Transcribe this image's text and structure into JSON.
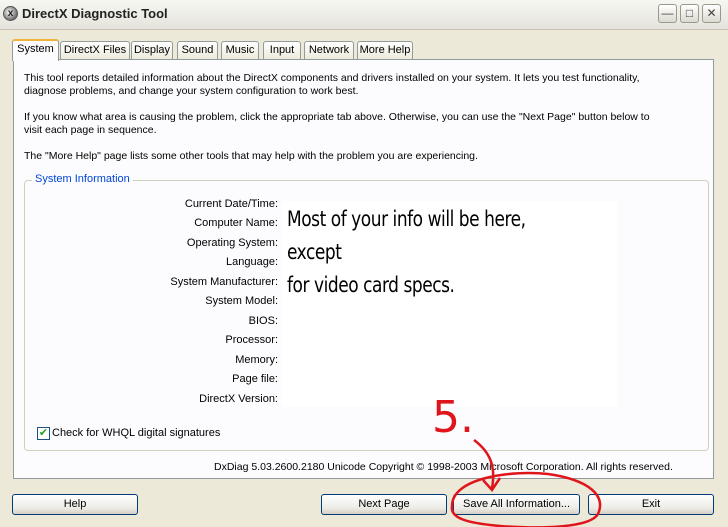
{
  "window": {
    "title": "DirectX Diagnostic Tool",
    "minimize": "—",
    "maximize": "□",
    "close": "✕"
  },
  "tabs": [
    "System",
    "DirectX Files",
    "Display",
    "Sound",
    "Music",
    "Input",
    "Network",
    "More Help"
  ],
  "intro": {
    "p1_line1": "This tool reports detailed information about the DirectX components and drivers installed on your system.  It lets you test functionality,",
    "p1_line2": "diagnose problems, and change your system configuration to work best.",
    "p2_line1": "If you know what area is causing the problem, click the appropriate tab above.  Otherwise, you can use the \"Next Page\" button below to",
    "p2_line2": "visit each page in sequence.",
    "p3": "The \"More Help\" page lists some other tools that may help with the problem you are experiencing."
  },
  "system_info": {
    "group_label": "System Information",
    "labels": [
      "Current Date/Time:",
      "Computer Name:",
      "Operating System:",
      "Language:",
      "System Manufacturer:",
      "System Model:",
      "BIOS:",
      "Processor:",
      "Memory:",
      "Page file:",
      "DirectX Version:"
    ],
    "note_line1": "Most of your info will be here, except",
    "note_line2": "for video card specs."
  },
  "whql_checkbox": {
    "label": "Check for WHQL digital signatures",
    "checked": true
  },
  "footer": "DxDiag 5.03.2600.2180 Unicode  Copyright © 1998-2003 Microsoft Corporation.  All rights reserved.",
  "buttons": {
    "help": "Help",
    "next_page": "Next Page",
    "save_all": "Save All Information...",
    "exit": "Exit"
  },
  "annotation": {
    "step": "5.",
    "color": "#e0151b"
  }
}
